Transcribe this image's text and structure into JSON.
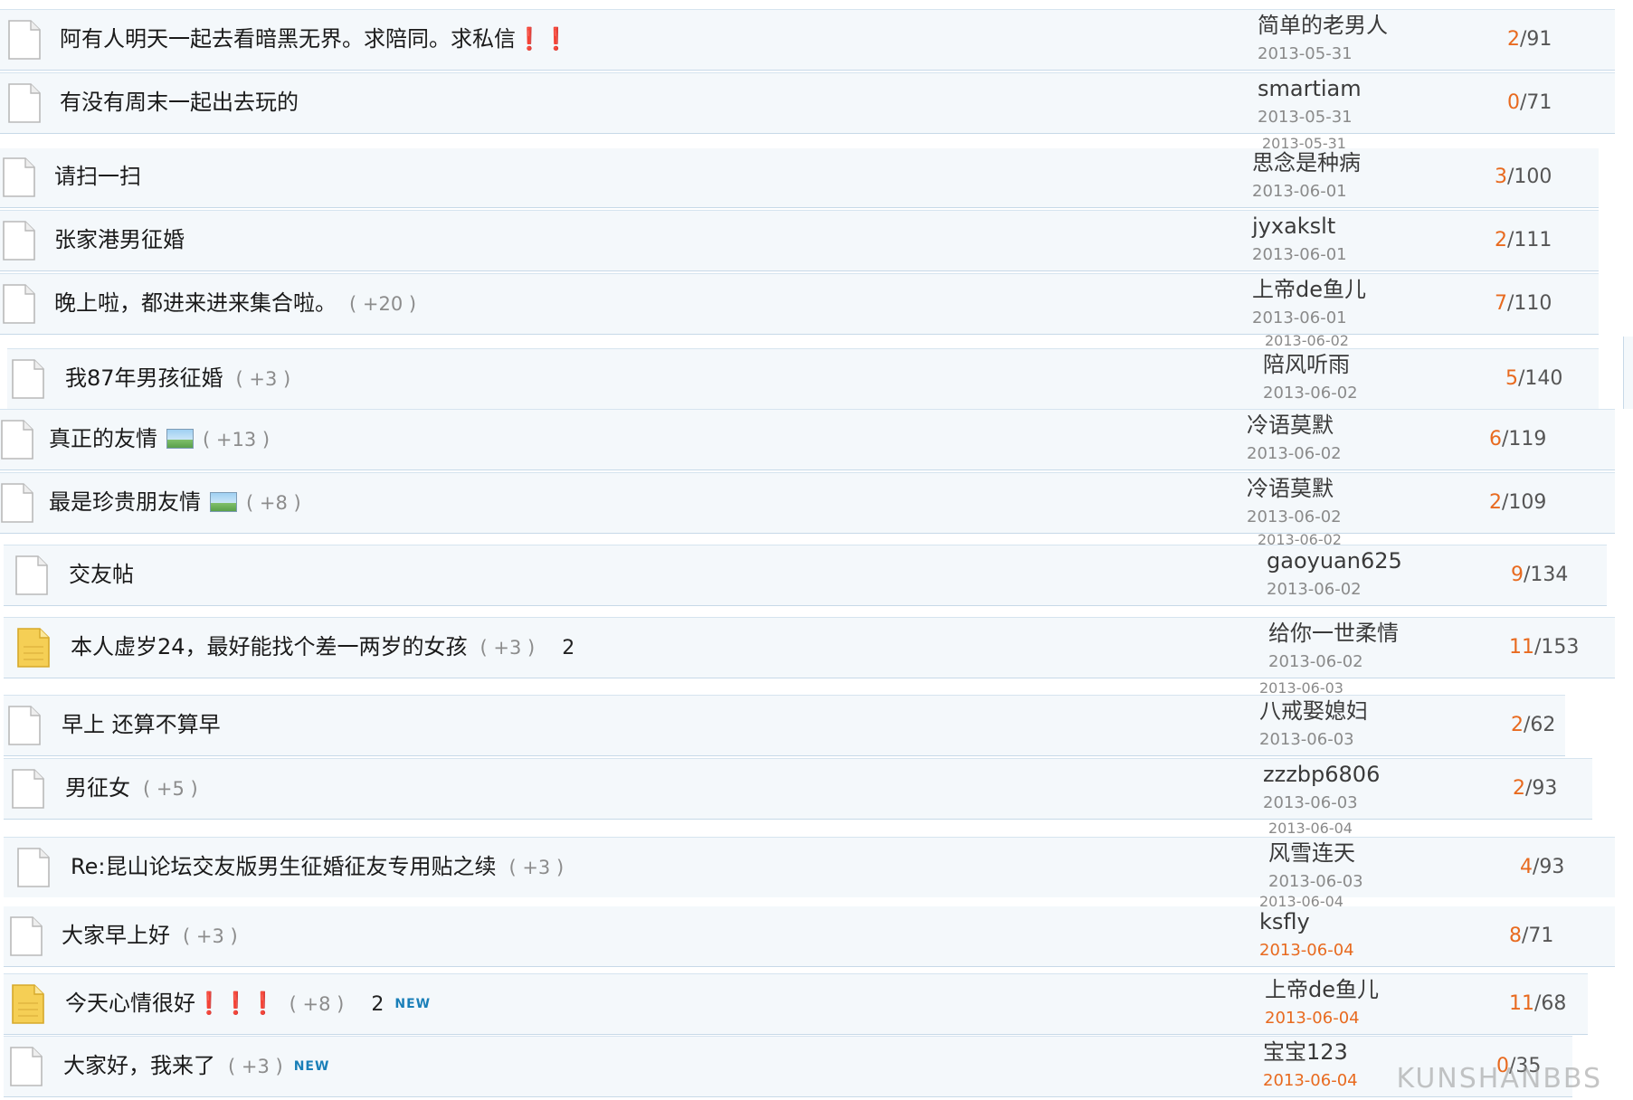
{
  "threads": [
    {
      "title": "阿有人明天一起去看暗黑无界。求陪同。求私信❗❗",
      "extra": "",
      "has_image": false,
      "page": "",
      "is_new": false,
      "hot": false,
      "author": "简单的老男人",
      "date": "2013-05-31",
      "date_recent": false,
      "replies": "2",
      "views": "91"
    },
    {
      "title": "有没有周末一起出去玩的",
      "extra": "",
      "has_image": false,
      "page": "",
      "is_new": false,
      "hot": false,
      "author": "smartiam",
      "date": "2013-05-31",
      "date_recent": false,
      "replies": "0",
      "views": "71"
    },
    {
      "title": "请扫一扫",
      "extra": "",
      "has_image": false,
      "page": "",
      "is_new": false,
      "hot": false,
      "author": "思念是种病",
      "date": "2013-06-01",
      "date_recent": false,
      "replies": "3",
      "views": "100"
    },
    {
      "title": "张家港男征婚",
      "extra": "",
      "has_image": false,
      "page": "",
      "is_new": false,
      "hot": false,
      "author": "jyxakslt",
      "date": "2013-06-01",
      "date_recent": false,
      "replies": "2",
      "views": "111"
    },
    {
      "title": "晚上啦，都进来进来集合啦。",
      "extra": "( +20 )",
      "has_image": false,
      "page": "",
      "is_new": false,
      "hot": false,
      "author": "上帝de鱼儿",
      "date": "2013-06-01",
      "date_recent": false,
      "replies": "7",
      "views": "110"
    },
    {
      "title": "我87年男孩征婚",
      "extra": "( +3 )",
      "has_image": false,
      "page": "",
      "is_new": false,
      "hot": false,
      "author": "陪风听雨",
      "date": "2013-06-02",
      "date_recent": false,
      "replies": "5",
      "views": "140"
    },
    {
      "title": "真正的友情",
      "extra": "( +13 )",
      "has_image": true,
      "page": "",
      "is_new": false,
      "hot": false,
      "author": "冷语莫默",
      "date": "2013-06-02",
      "date_recent": false,
      "replies": "6",
      "views": "119"
    },
    {
      "title": "最是珍贵朋友情",
      "extra": "( +8 )",
      "has_image": true,
      "page": "",
      "is_new": false,
      "hot": false,
      "author": "冷语莫默",
      "date": "2013-06-02",
      "date_recent": false,
      "replies": "2",
      "views": "109"
    },
    {
      "title": "交友帖",
      "extra": "",
      "has_image": false,
      "page": "",
      "is_new": false,
      "hot": false,
      "author": "gaoyuan625",
      "date": "2013-06-02",
      "date_recent": false,
      "replies": "9",
      "views": "134"
    },
    {
      "title": "本人虚岁24，最好能找个差一两岁的女孩",
      "extra": "( +3 )",
      "has_image": false,
      "page": "2",
      "is_new": false,
      "hot": true,
      "author": "给你一世柔情",
      "date": "2013-06-02",
      "date_recent": false,
      "replies": "11",
      "views": "153"
    },
    {
      "title": "早上 还算不算早",
      "extra": "",
      "has_image": false,
      "page": "",
      "is_new": false,
      "hot": false,
      "author": "八戒娶媳妇",
      "date": "2013-06-03",
      "date_recent": false,
      "replies": "2",
      "views": "62"
    },
    {
      "title": "男征女",
      "extra": "( +5 )",
      "has_image": false,
      "page": "",
      "is_new": false,
      "hot": false,
      "author": "zzzbp6806",
      "date": "2013-06-03",
      "date_recent": false,
      "replies": "2",
      "views": "93"
    },
    {
      "title": "Re:昆山论坛交友版男生征婚征友专用贴之续",
      "extra": "( +3 )",
      "has_image": false,
      "page": "",
      "is_new": false,
      "hot": false,
      "author": "风雪连天",
      "date": "2013-06-03",
      "date_recent": false,
      "replies": "4",
      "views": "93"
    },
    {
      "title": "大家早上好",
      "extra": "( +3 )",
      "has_image": false,
      "page": "",
      "is_new": false,
      "hot": false,
      "author": "ksfly",
      "date": "2013-06-04",
      "date_recent": true,
      "replies": "8",
      "views": "71"
    },
    {
      "title": "今天心情很好❗❗❗",
      "extra": "( +8 )",
      "has_image": false,
      "page": "2",
      "is_new": true,
      "hot": true,
      "author": "上帝de鱼儿",
      "date": "2013-06-04",
      "date_recent": true,
      "replies": "11",
      "views": "68"
    },
    {
      "title": "大家好，我来了",
      "extra": "( +3 )",
      "has_image": false,
      "page": "",
      "is_new": true,
      "hot": false,
      "author": "宝宝123",
      "date": "2013-06-04",
      "date_recent": true,
      "replies": "0",
      "views": "35"
    }
  ],
  "new_badge": "NEW",
  "stats_sep": "/",
  "seam_labels": [
    "2013-05-31",
    "2013-06-02",
    "2013-06-03",
    "2013-06-04"
  ],
  "watermark": "KUNSHANBBS",
  "colors": {
    "row_bg": "#f4f8fb",
    "row_border": "#c7d9e8",
    "reply_count": "#e86a1f",
    "recent_date": "#e86a1f",
    "new_badge": "#1a7fb8",
    "hot_icon": "#f5cf55"
  },
  "icons": {
    "normal": "document-icon",
    "hot": "hot-document-icon",
    "image": "image-attachment-icon"
  }
}
